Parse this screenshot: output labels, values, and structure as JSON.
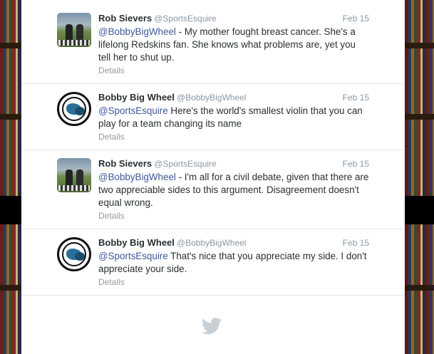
{
  "tweets": [
    {
      "name": "Rob Sievers",
      "handle": "@SportsEsquire",
      "date": "Feb 15",
      "mention": "@BobbyBigWheel",
      "text": " - My mother fought breast cancer. She's a lifelong Redskins fan. She knows what problems are, yet you tell her to shut up.",
      "details": "Details",
      "avatar": "person-photo-avatar"
    },
    {
      "name": "Bobby Big Wheel",
      "handle": "@BobbyBigWheel",
      "date": "Feb 15",
      "mention": "@SportsEsquire",
      "text": " Here's the world's smallest violin that you can play for a team changing its name",
      "details": "Details",
      "avatar": "logo-avatar"
    },
    {
      "name": "Rob Sievers",
      "handle": "@SportsEsquire",
      "date": "Feb 15",
      "mention": "@BobbyBigWheel",
      "text": " - I'm all for a civil debate, given that there are two appreciable sides to this argument. Disagreement doesn't equal wrong.",
      "details": "Details",
      "avatar": "person-photo-avatar"
    },
    {
      "name": "Bobby Big Wheel",
      "handle": "@BobbyBigWheel",
      "date": "Feb 15",
      "mention": "@SportsEsquire",
      "text": " That's nice that you appreciate my side. I don't appreciate your side.",
      "details": "Details",
      "avatar": "logo-avatar"
    }
  ],
  "footer": {
    "icon": "twitter-bird-icon"
  },
  "colors": {
    "mention": "#3b5998",
    "meta": "#8899a6",
    "text": "#292f33"
  }
}
